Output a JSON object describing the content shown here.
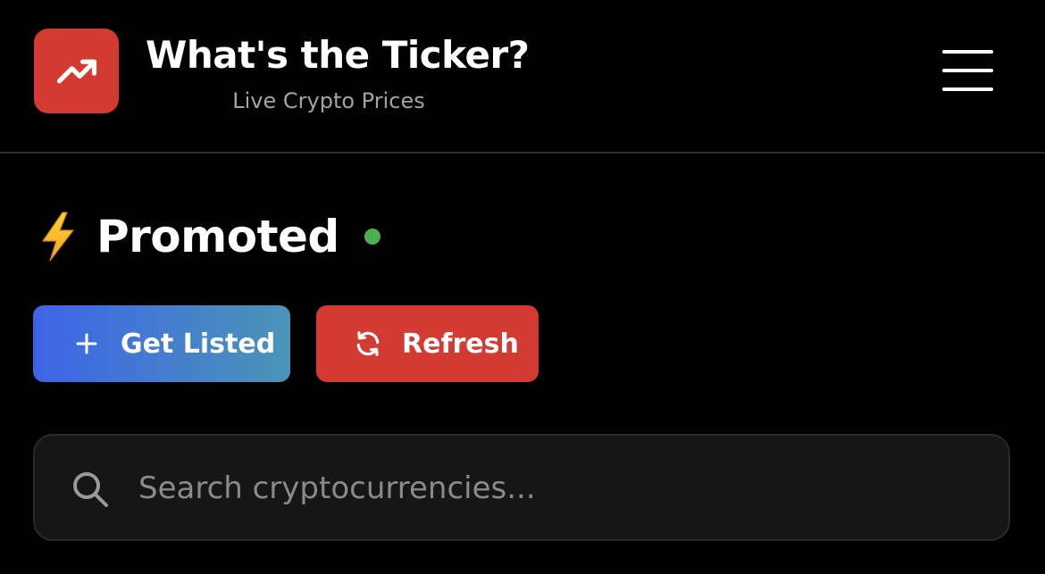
{
  "header": {
    "title": "What's the Ticker?",
    "subtitle": "Live Crypto Prices",
    "logo_icon": "trending-up-icon",
    "menu_icon": "hamburger-menu-icon"
  },
  "promoted": {
    "icon": "lightning-bolt-icon",
    "title": "Promoted",
    "status": "live",
    "status_color": "#4caf50"
  },
  "actions": {
    "get_listed_label": "Get Listed",
    "get_listed_icon": "plus-icon",
    "refresh_label": "Refresh",
    "refresh_icon": "refresh-icon"
  },
  "search": {
    "placeholder": "Search cryptocurrencies...",
    "value": "",
    "icon": "search-icon"
  },
  "colors": {
    "background": "#000000",
    "accent_red": "#d33a31",
    "gradient_start": "#3d64e8",
    "gradient_end": "#4a95b6",
    "search_bg": "#161616",
    "muted_text": "#a3a3a3"
  }
}
